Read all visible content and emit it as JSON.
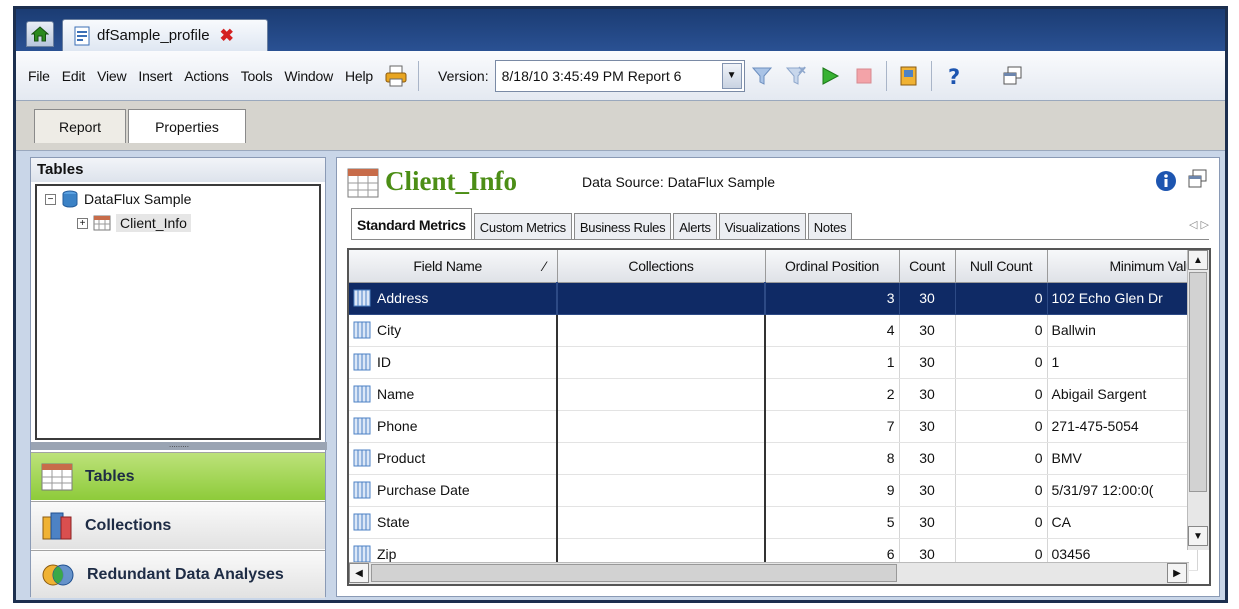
{
  "doc_tab": {
    "title": "dfSample_profile",
    "close": "✖"
  },
  "menu": {
    "items": [
      "File",
      "Edit",
      "View",
      "Insert",
      "Actions",
      "Tools",
      "Window",
      "Help"
    ]
  },
  "toolbar": {
    "version_label": "Version:",
    "version_value": "8/18/10 3:45:49 PM  Report 6"
  },
  "subtabs": {
    "report": "Report",
    "properties": "Properties"
  },
  "left": {
    "header": "Tables",
    "tree": {
      "root": "DataFlux Sample",
      "child": "Client_Info"
    },
    "nav": {
      "tables": "Tables",
      "collections": "Collections",
      "redundant": "Redundant Data Analyses"
    }
  },
  "main": {
    "title": "Client_Info",
    "data_source": "Data Source: DataFlux Sample",
    "tabs": [
      "Standard Metrics",
      "Custom Metrics",
      "Business Rules",
      "Alerts",
      "Visualizations",
      "Notes"
    ],
    "columns": [
      "Field Name",
      "Collections",
      "Ordinal Position",
      "Count",
      "Null Count",
      "Minimum Valu"
    ],
    "rows": [
      {
        "field": "Address",
        "collections": "",
        "ordinal": "3",
        "count": "30",
        "nulls": "0",
        "min": "102 Echo Glen Dr"
      },
      {
        "field": "City",
        "collections": "",
        "ordinal": "4",
        "count": "30",
        "nulls": "0",
        "min": "Ballwin"
      },
      {
        "field": "ID",
        "collections": "",
        "ordinal": "1",
        "count": "30",
        "nulls": "0",
        "min": "1"
      },
      {
        "field": "Name",
        "collections": "",
        "ordinal": "2",
        "count": "30",
        "nulls": "0",
        "min": "Abigail Sargent"
      },
      {
        "field": "Phone",
        "collections": "",
        "ordinal": "7",
        "count": "30",
        "nulls": "0",
        "min": "271-475-5054"
      },
      {
        "field": "Product",
        "collections": "",
        "ordinal": "8",
        "count": "30",
        "nulls": "0",
        "min": "BMV"
      },
      {
        "field": "Purchase Date",
        "collections": "",
        "ordinal": "9",
        "count": "30",
        "nulls": "0",
        "min": "5/31/97 12:00:0("
      },
      {
        "field": "State",
        "collections": "",
        "ordinal": "5",
        "count": "30",
        "nulls": "0",
        "min": "CA"
      },
      {
        "field": "Zip",
        "collections": "",
        "ordinal": "6",
        "count": "30",
        "nulls": "0",
        "min": "03456"
      }
    ],
    "selected_row": 0
  },
  "colors": {
    "title_green": "#4c8e16",
    "selection": "#0f2a65",
    "nav_active": "#8ecb3a",
    "frame": "#1c2f4f"
  }
}
